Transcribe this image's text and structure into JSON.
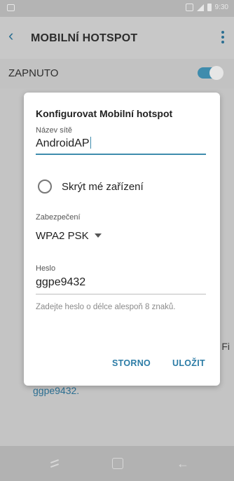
{
  "statusbar": {
    "time": "9:30"
  },
  "appbar": {
    "title": "MOBILNÍ HOTSPOT"
  },
  "switch_row": {
    "label": "ZAPNUTO",
    "on": true
  },
  "underlying": {
    "password_snippet": "ggpe9432.",
    "right_text": "Fi"
  },
  "dialog": {
    "title": "Konfigurovat Mobilní hotspot",
    "network_name_label": "Název sítě",
    "network_name_value": "AndroidAP",
    "hide_device_label": "Skrýt mé zařízení",
    "security_label": "Zabezpečení",
    "security_value": "WPA2 PSK",
    "password_label": "Heslo",
    "password_value": "ggpe9432",
    "password_hint": "Zadejte heslo o délce alespoň 8 znaků.",
    "cancel_label": "STORNO",
    "save_label": "ULOŽIT"
  },
  "colors": {
    "accent": "#3f8cad",
    "button_text": "#2c7ca6"
  },
  "icons": [
    "back-arrow-icon",
    "more-options-icon",
    "nav-recents-icon",
    "nav-home-icon",
    "nav-back-icon"
  ]
}
